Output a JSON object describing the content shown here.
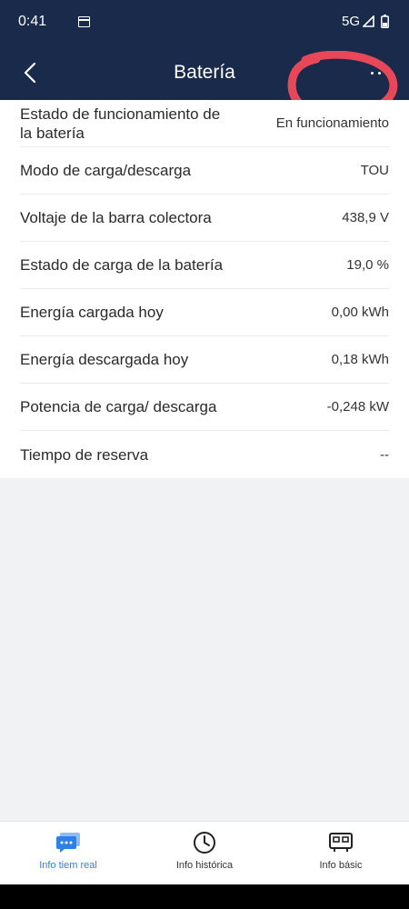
{
  "status": {
    "time": "0:41",
    "network": "5G"
  },
  "header": {
    "title": "Batería"
  },
  "rows": [
    {
      "label": "Estado de funcionamiento de la batería",
      "value": "En funcionamiento"
    },
    {
      "label": "Modo de carga/descarga",
      "value": "TOU"
    },
    {
      "label": "Voltaje de la barra colectora",
      "value": "438,9 V"
    },
    {
      "label": "Estado de carga de la batería",
      "value": "19,0 %"
    },
    {
      "label": "Energía cargada hoy",
      "value": "0,00 kWh"
    },
    {
      "label": "Energía descargada hoy",
      "value": "0,18 kWh"
    },
    {
      "label": "Potencia de carga/ descarga",
      "value": "-0,248 kW"
    },
    {
      "label": "Tiempo de reserva",
      "value": "--"
    }
  ],
  "nav": [
    {
      "label": "Info tiem real",
      "icon": "realtime-info-icon",
      "active": true
    },
    {
      "label": "Info histórica",
      "icon": "clock-icon",
      "active": false
    },
    {
      "label": "Info básic",
      "icon": "device-info-icon",
      "active": false
    }
  ],
  "colors": {
    "header_bg": "#1a2a4a",
    "accent": "#2f7fe8",
    "annotation": "#e8475a"
  }
}
